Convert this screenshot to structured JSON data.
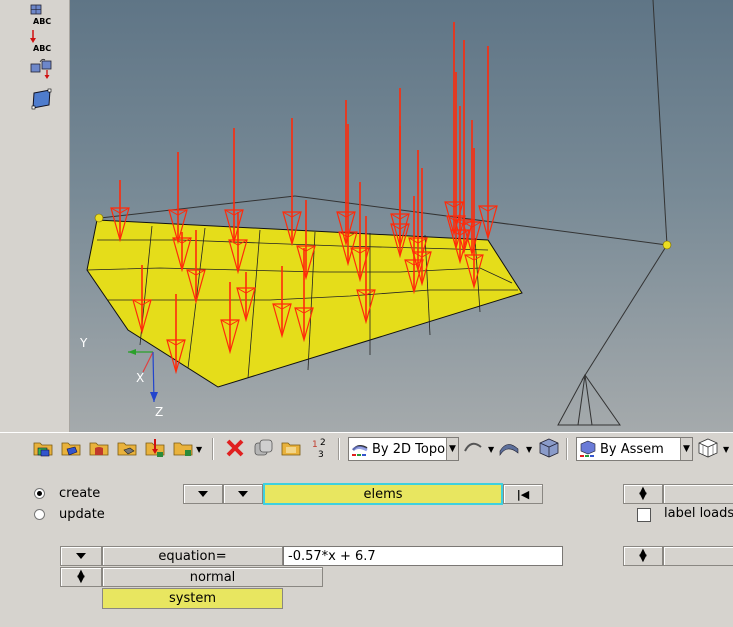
{
  "left_toolbar": {
    "icons": [
      "grid-abc-icon",
      "load-abc-icon",
      "transfer-icon",
      "surface-select-icon"
    ],
    "abc_text": "ABC"
  },
  "viewport": {
    "axis_labels": {
      "y": "Y",
      "x": "X",
      "z": "Z"
    },
    "colors": {
      "surface": "#e5dd1a",
      "arrow": "#ff2a0a",
      "node": "#eadd22"
    }
  },
  "toolbar": {
    "topo_dropdown": "By 2D Topo",
    "assem_dropdown": "By Assem"
  },
  "panel": {
    "mode": {
      "create_label": "create",
      "update_label": "update",
      "selected": "create"
    },
    "entity_selector": "elems",
    "label_loads": {
      "label": "label loads",
      "checked": false
    },
    "equation_button": "equation=",
    "equation_value": "-0.57*x + 6.7",
    "direction_selector": "normal",
    "system_button": "system"
  }
}
